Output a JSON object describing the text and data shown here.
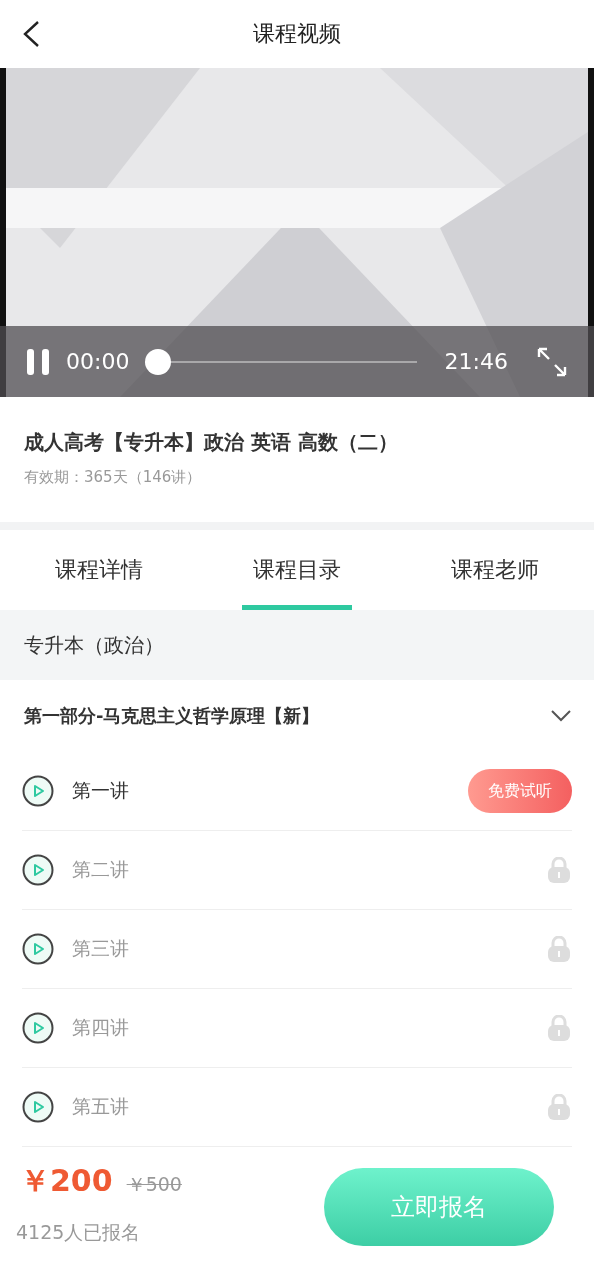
{
  "header": {
    "title": "课程视频"
  },
  "player": {
    "playing": true,
    "current_time": "00:00",
    "duration": "21:46",
    "level": 0
  },
  "course": {
    "title": "成人高考【专升本】政治 英语 高数（二）",
    "validity": "有效期：365天（146讲）"
  },
  "tabs": [
    {
      "label": "课程详情",
      "selected": false
    },
    {
      "label": "课程目录",
      "selected": true
    },
    {
      "label": "课程老师",
      "selected": false
    }
  ],
  "section": {
    "title": "专升本（政治）"
  },
  "chapter": {
    "title": "第一部分-马克思主义哲学原理【新】",
    "expanded": true
  },
  "lessons": [
    {
      "title": "第一讲",
      "kind": "trial",
      "badge": "免费试听"
    },
    {
      "title": "第二讲",
      "kind": "locked"
    },
    {
      "title": "第三讲",
      "kind": "locked"
    },
    {
      "title": "第四讲",
      "kind": "locked"
    },
    {
      "title": "第五讲",
      "kind": "locked"
    }
  ],
  "footer": {
    "price": "￥200",
    "original_price": "￥500",
    "enrolled": "4125人已报名",
    "button": "立即报名"
  }
}
